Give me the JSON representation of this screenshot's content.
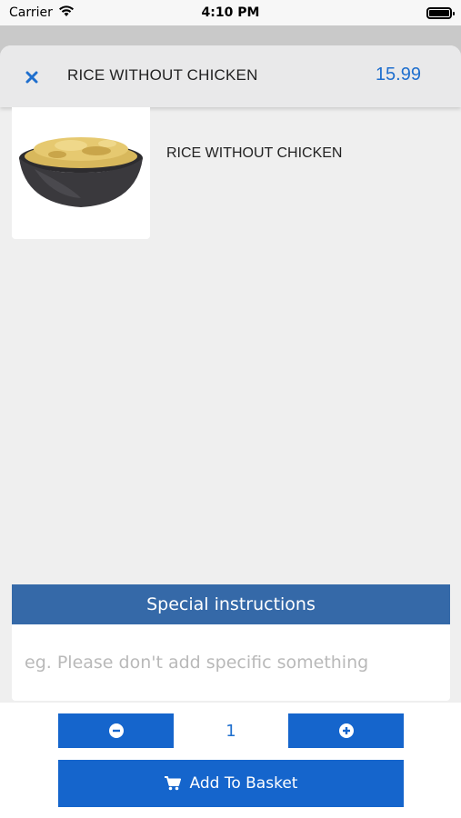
{
  "status_bar": {
    "carrier": "Carrier",
    "time": "4:10 PM"
  },
  "header": {
    "title": "RICE WITHOUT CHICKEN",
    "price": "15.99",
    "close_icon": "close-icon"
  },
  "product": {
    "name": "RICE WITHOUT CHICKEN",
    "image_icon": "rice-bowl-image"
  },
  "special_instructions": {
    "title": "Special instructions",
    "placeholder": "eg. Please don't add specific something",
    "value": ""
  },
  "quantity": {
    "value": "1",
    "minus_icon": "minus-circle-icon",
    "plus_icon": "plus-circle-icon"
  },
  "add_button": {
    "label": "Add To Basket",
    "icon": "cart-icon"
  },
  "colors": {
    "accent": "#1565cc",
    "header_blue": "#3569a8",
    "price_blue": "#1f6fce"
  }
}
